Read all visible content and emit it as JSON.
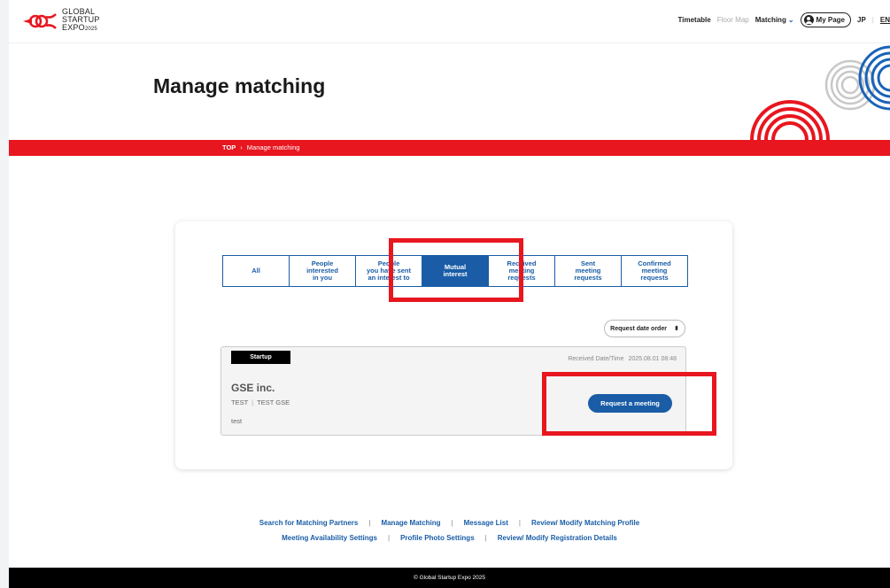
{
  "header": {
    "logo_line1": "GLOBAL",
    "logo_line2": "STARTUP",
    "logo_line3": "EXPO",
    "logo_year": "2025",
    "nav": {
      "timetable": "Timetable",
      "floor_map": "Floor Map",
      "matching": "Matching",
      "my_page": "My Page",
      "jp": "JP",
      "separator": "|",
      "en": "EN"
    }
  },
  "hero": {
    "title": "Manage matching"
  },
  "breadcrumb": {
    "top": "TOP",
    "separator": "›",
    "current": "Manage matching"
  },
  "tabs": [
    {
      "label": "All",
      "active": false
    },
    {
      "label": "People\ninterested\nin you",
      "active": false
    },
    {
      "label": "People\nyou have sent\nan interest to",
      "active": false
    },
    {
      "label": "Mutual\ninterest",
      "active": true
    },
    {
      "label": "Received\nmeeting\nrequests",
      "active": false
    },
    {
      "label": "Sent\nmeeting\nrequests",
      "active": false
    },
    {
      "label": "Confirmed\nmeeting\nrequests",
      "active": false
    }
  ],
  "sort": {
    "label": "Request date order",
    "icon": "updown-arrows-icon"
  },
  "result": {
    "badge": "Startup",
    "received_label": "Received Date/Time",
    "received_value": "2025.08.01 08:48",
    "company": "GSE inc.",
    "tag1": "TEST",
    "tag_sep": "|",
    "tag2": "TEST GSE",
    "description": "test",
    "button": "Request a meeting"
  },
  "footer_links": {
    "row1": [
      "Search for Matching Partners",
      "Manage Matching",
      "Message List",
      "Review/ Modify Matching Profile"
    ],
    "row2": [
      "Meeting Availability Settings",
      "Profile Photo Settings",
      "Review/ Modify Registration Details"
    ],
    "separator": "|"
  },
  "copyright": "© Global Startup Expo 2025",
  "colors": {
    "brand_red": "#e8161f",
    "primary_blue": "#1a5da6",
    "annotation_red": "#e8161f"
  }
}
